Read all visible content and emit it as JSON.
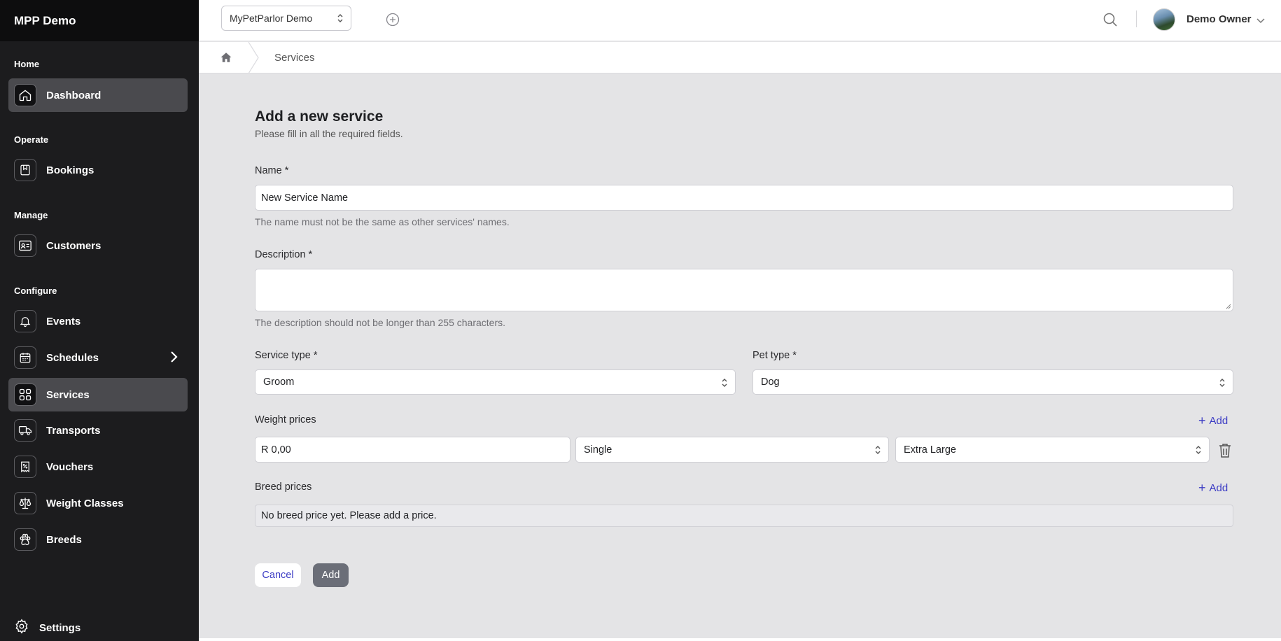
{
  "app": {
    "title": "MPP Demo"
  },
  "sidebar": {
    "sections": {
      "home": "Home",
      "operate": "Operate",
      "manage": "Manage",
      "configure": "Configure"
    },
    "items": [
      {
        "label": "Dashboard",
        "icon": "home-icon",
        "active": true
      },
      {
        "label": "Bookings",
        "icon": "bookmark-book-icon"
      },
      {
        "label": "Customers",
        "icon": "id-card-icon"
      },
      {
        "label": "Events",
        "icon": "bell-icon"
      },
      {
        "label": "Schedules",
        "icon": "calendar-icon"
      },
      {
        "label": "Services",
        "icon": "grid-icon",
        "active": true
      },
      {
        "label": "Transports",
        "icon": "truck-icon"
      },
      {
        "label": "Vouchers",
        "icon": "voucher-icon"
      },
      {
        "label": "Weight Classes",
        "icon": "scale-icon"
      },
      {
        "label": "Breeds",
        "icon": "paw-icon"
      }
    ],
    "settings_label": "Settings"
  },
  "topbar": {
    "org_select_value": "MyPetParlor Demo",
    "user_name": "Demo Owner"
  },
  "breadcrumb": {
    "current": "Services"
  },
  "form": {
    "title": "Add a new service",
    "subtitle": "Please fill in all the required fields.",
    "name_label": "Name *",
    "name_value": "New Service Name",
    "name_hint": "The name must not be the same as other services' names.",
    "description_label": "Description *",
    "description_value": "",
    "description_hint": "The description should not be longer than 255 characters.",
    "service_type_label": "Service type *",
    "service_type_value": "Groom",
    "pet_type_label": "Pet type *",
    "pet_type_value": "Dog",
    "weight_prices_label": "Weight prices",
    "add_label": "Add",
    "weight_price_row": {
      "price": "R 0,00",
      "mode": "Single",
      "weight_class": "Extra Large"
    },
    "breed_prices_label": "Breed prices",
    "breed_empty": "No breed price yet. Please add a price.",
    "cancel_label": "Cancel",
    "submit_label": "Add"
  },
  "colors": {
    "sidebar_bg": "#1c1c1e",
    "accent_link": "#3b3bc4",
    "primary_button": "#6b6e78"
  }
}
